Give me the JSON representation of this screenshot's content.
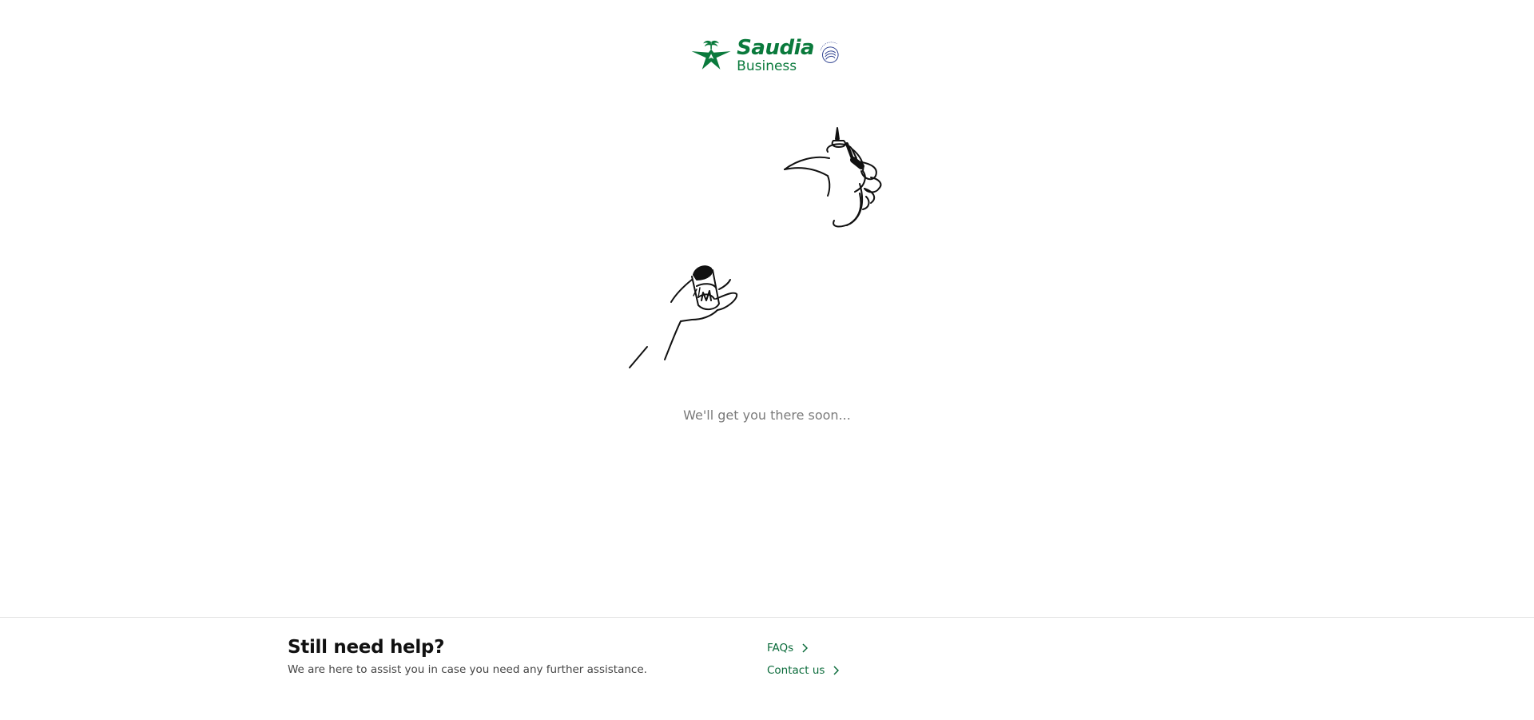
{
  "logo": {
    "brand": "Saudia",
    "sub": "Business",
    "color": "#0a7a3c",
    "icon": "saudia-palm-logo-icon",
    "partner_icon": "skyteam-icon"
  },
  "illustration": {
    "icon": "coffee-pot-pouring-illustration"
  },
  "loading": {
    "message": "We'll get you there soon..."
  },
  "footer": {
    "title": "Still need help?",
    "description": "We are here to assist you in case you need any further assistance.",
    "links": [
      {
        "label": "FAQs",
        "icon": "chevron-right-icon"
      },
      {
        "label": "Contact us",
        "icon": "chevron-right-icon"
      }
    ],
    "link_color": "#0a6b3a"
  }
}
